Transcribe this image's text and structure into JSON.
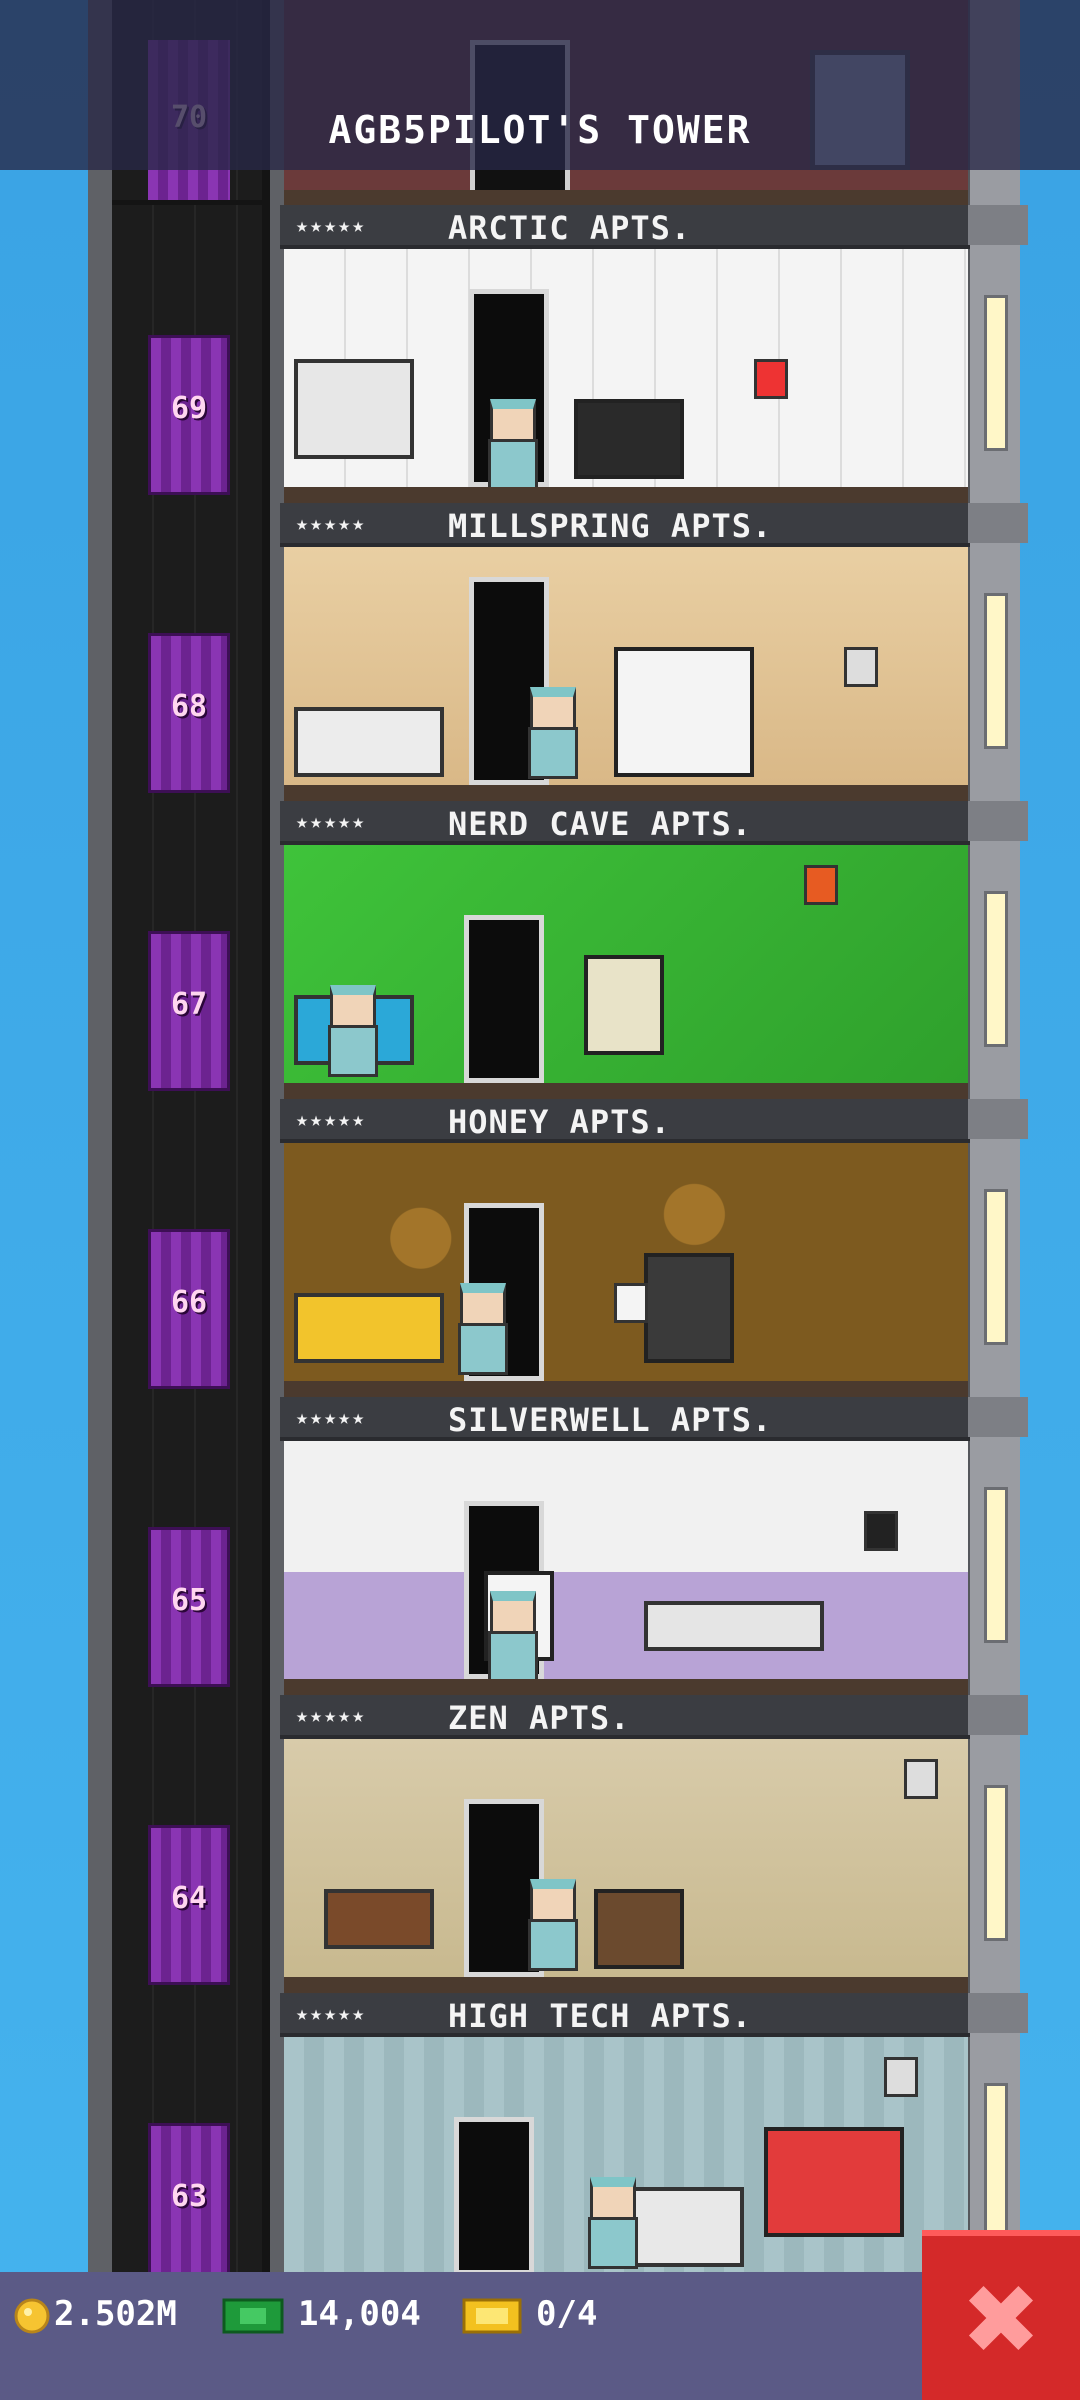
{
  "header": {
    "title": "AGB5PILOT'S TOWER",
    "top_floor_number": "70"
  },
  "floors": [
    {
      "number": "69",
      "name": "ARCTIC APTS.",
      "stars": "★★★★★"
    },
    {
      "number": "68",
      "name": "MILLSPRING APTS.",
      "stars": "★★★★★"
    },
    {
      "number": "67",
      "name": "NERD CAVE APTS.",
      "stars": "★★★★★"
    },
    {
      "number": "66",
      "name": "HONEY APTS.",
      "stars": "★★★★★"
    },
    {
      "number": "65",
      "name": "SILVERWELL APTS.",
      "stars": "★★★★★"
    },
    {
      "number": "64",
      "name": "ZEN APTS.",
      "stars": "★★★★★"
    },
    {
      "number": "63",
      "name": "HIGH TECH APTS.",
      "stars": "★★★★★"
    }
  ],
  "status_bar": {
    "coins": "2.502M",
    "tower_bux": "14,004",
    "tickets": "0/4"
  },
  "colors": {
    "sky": "#3aa6e6",
    "elevator": "#7a2aa0",
    "close_button": "#d42929",
    "bottom_bar": "#5b5a86"
  },
  "icons": {
    "coin": "coin-icon",
    "bux": "tower-bux-icon",
    "ticket": "ticket-icon",
    "close": "close-icon"
  }
}
